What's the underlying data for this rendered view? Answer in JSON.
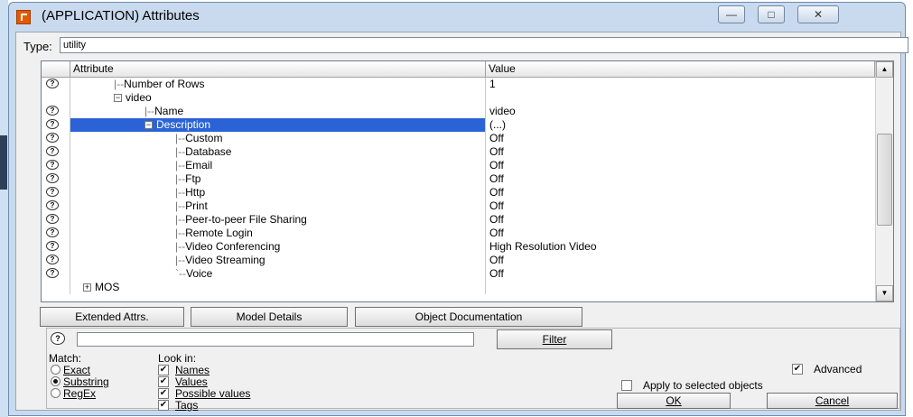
{
  "window": {
    "title": "(APPLICATION) Attributes",
    "controls": {
      "minimize": "—",
      "maximize": "□",
      "close": "✕"
    }
  },
  "type_field": {
    "label": "Type:",
    "value": "utility"
  },
  "grid": {
    "columns": {
      "attribute": "Attribute",
      "value": "Value"
    },
    "rows": [
      {
        "icon": true,
        "indent": 1,
        "prefix": "|-- ",
        "label": "Number of Rows",
        "value": "1",
        "selected": false
      },
      {
        "icon": false,
        "indent": 1,
        "prefix": "",
        "expander": "⊟",
        "label": "video",
        "value": "",
        "selected": false
      },
      {
        "icon": true,
        "indent": 2,
        "prefix": "|-- ",
        "label": "Name",
        "value": "video",
        "selected": false
      },
      {
        "icon": true,
        "indent": 2,
        "prefix": "",
        "expander": "⊟",
        "label": "Description",
        "value": "(...)",
        "selected": true
      },
      {
        "icon": true,
        "indent": 3,
        "prefix": "|-- ",
        "label": "Custom",
        "value": "Off",
        "selected": false
      },
      {
        "icon": true,
        "indent": 3,
        "prefix": "|-- ",
        "label": "Database",
        "value": "Off",
        "selected": false
      },
      {
        "icon": true,
        "indent": 3,
        "prefix": "|-- ",
        "label": "Email",
        "value": "Off",
        "selected": false
      },
      {
        "icon": true,
        "indent": 3,
        "prefix": "|-- ",
        "label": "Ftp",
        "value": "Off",
        "selected": false
      },
      {
        "icon": true,
        "indent": 3,
        "prefix": "|-- ",
        "label": "Http",
        "value": "Off",
        "selected": false
      },
      {
        "icon": true,
        "indent": 3,
        "prefix": "|-- ",
        "label": "Print",
        "value": "Off",
        "selected": false
      },
      {
        "icon": true,
        "indent": 3,
        "prefix": "|-- ",
        "label": "Peer-to-peer File Sharing",
        "value": "Off",
        "selected": false
      },
      {
        "icon": true,
        "indent": 3,
        "prefix": "|-- ",
        "label": "Remote Login",
        "value": "Off",
        "selected": false
      },
      {
        "icon": true,
        "indent": 3,
        "prefix": "|-- ",
        "label": "Video Conferencing",
        "value": "High Resolution Video",
        "selected": false
      },
      {
        "icon": true,
        "indent": 3,
        "prefix": "|-- ",
        "label": "Video Streaming",
        "value": "Off",
        "selected": false
      },
      {
        "icon": true,
        "indent": 3,
        "prefix": "`-- ",
        "label": "Voice",
        "value": "Off",
        "selected": false
      },
      {
        "icon": false,
        "indent": 0,
        "prefix": "",
        "expander": "⊞",
        "label": "MOS",
        "value": "",
        "selected": false
      }
    ]
  },
  "buttons": {
    "extended_attrs": "Extended Attrs.",
    "model_details": "Model Details",
    "object_documentation": "Object Documentation",
    "filter": "Filter",
    "ok": "OK",
    "cancel": "Cancel"
  },
  "filter_panel": {
    "filter_value": "",
    "match_label": "Match:",
    "match_options": [
      {
        "label": "Exact",
        "checked": false
      },
      {
        "label": "Substring",
        "checked": true
      },
      {
        "label": "RegEx",
        "checked": false
      }
    ],
    "look_in_label": "Look in:",
    "look_in_options": [
      {
        "label": "Names",
        "checked": true
      },
      {
        "label": "Values",
        "checked": true
      },
      {
        "label": "Possible values",
        "checked": true
      },
      {
        "label": "Tags",
        "checked": true
      }
    ]
  },
  "options": {
    "advanced": {
      "label": "Advanced",
      "checked": true
    },
    "apply_to_selected": {
      "label": "Apply to selected objects",
      "checked": false
    }
  },
  "colors": {
    "selection": "#2b63d6",
    "title_bg": "#c9daef",
    "app_icon": "#e35a00"
  }
}
